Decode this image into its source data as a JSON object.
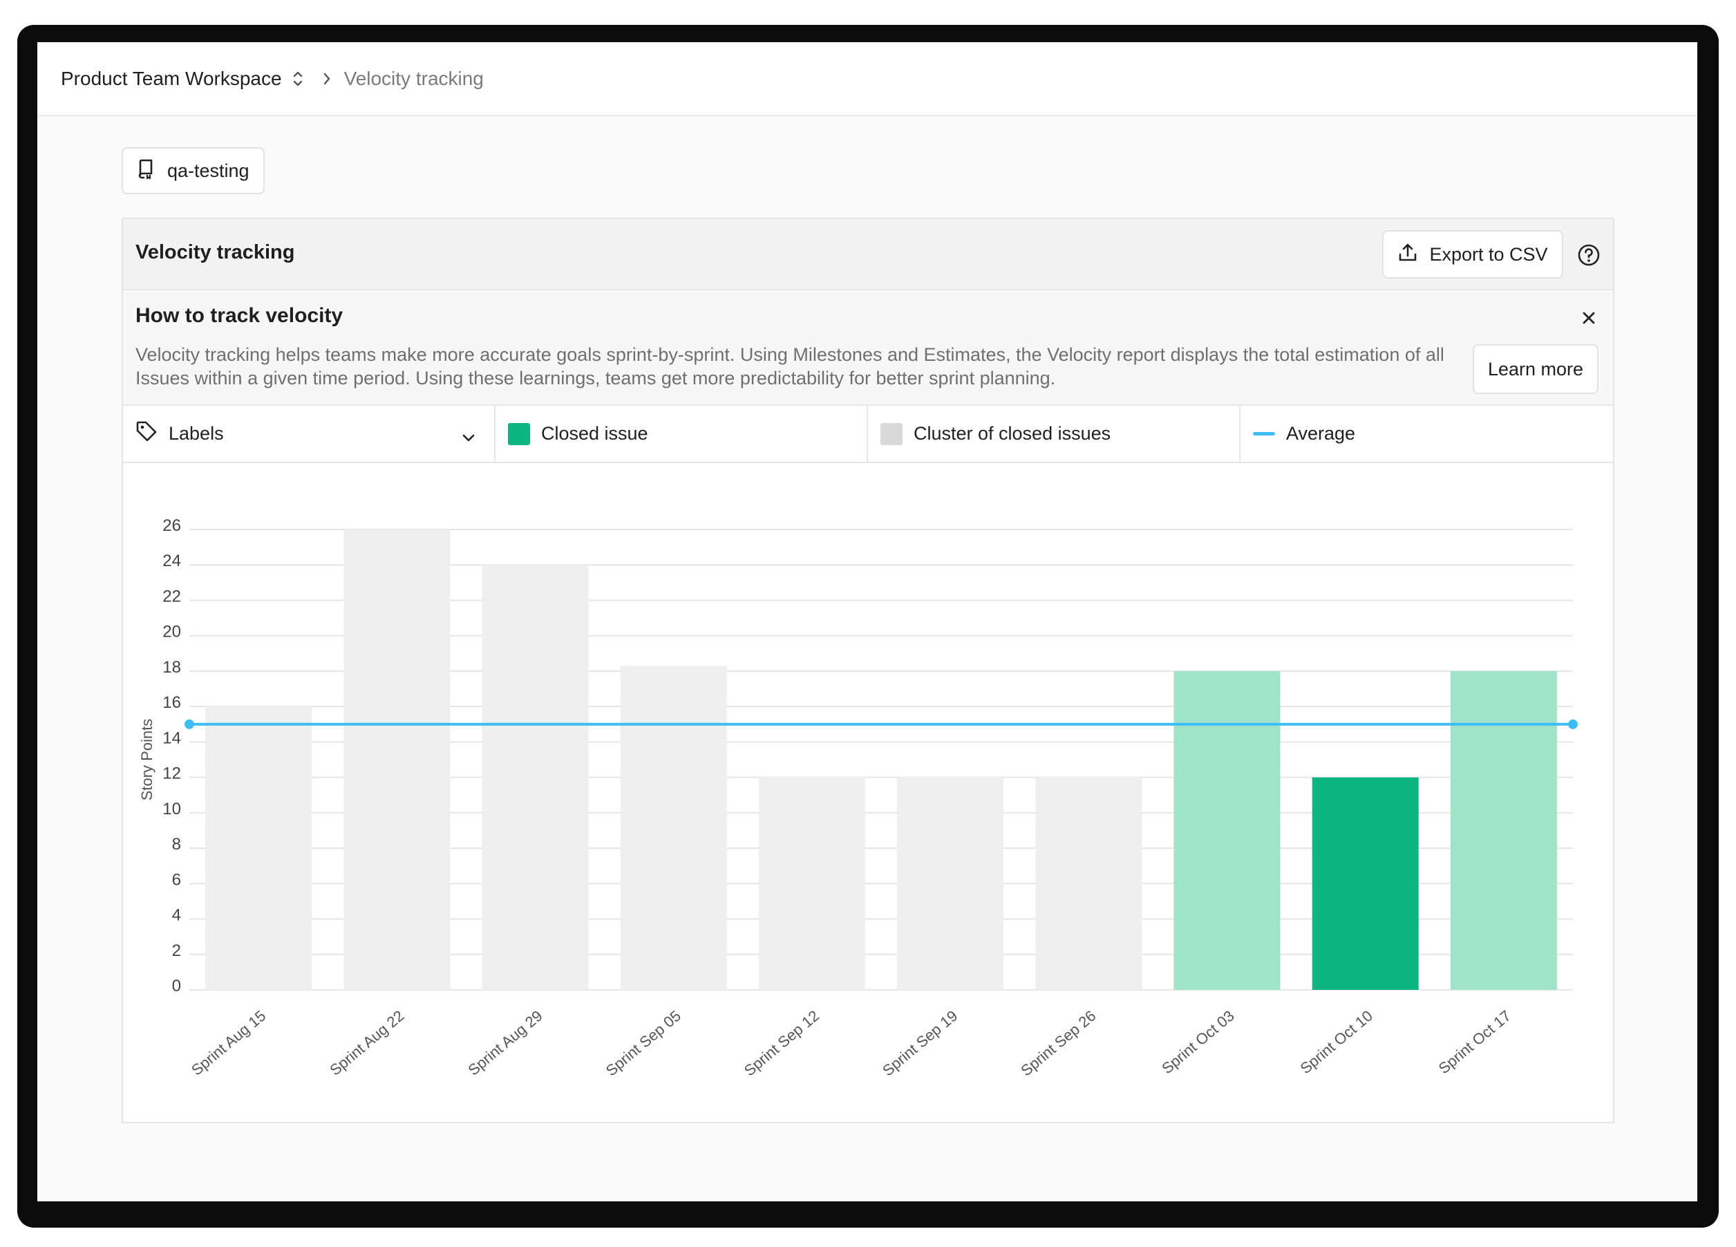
{
  "breadcrumb": {
    "workspace": "Product Team Workspace",
    "current": "Velocity tracking"
  },
  "repo_chip": {
    "label": "qa-testing",
    "icon": "repo-icon"
  },
  "card": {
    "title": "Velocity tracking",
    "export_label": "Export to CSV",
    "export_icon": "upload-icon",
    "help_icon": "question-circle-icon"
  },
  "info": {
    "title": "How to track velocity",
    "body": "Velocity tracking helps teams make more accurate goals sprint-by-sprint. Using Milestones and Estimates, the Velocity report displays the total estimation of all Issues within a given time period. Using these learnings, teams get more predictability for better sprint planning.",
    "learn_more": "Learn more",
    "close_icon": "close-icon"
  },
  "legend": {
    "labels": "Labels",
    "closed_issue": "Closed issue",
    "cluster": "Cluster of closed issues",
    "average": "Average"
  },
  "colors": {
    "closed_issue": "#0db57f",
    "closed_issue_light": "#9fe3c9",
    "cluster": "#d9d9d9",
    "cluster_bar": "#efefef",
    "average": "#3dbdf2"
  },
  "chart_data": {
    "type": "bar",
    "ylabel": "Story Points",
    "xlabel": "",
    "ylim": [
      0,
      26
    ],
    "yticks": [
      0,
      2,
      4,
      6,
      8,
      10,
      12,
      14,
      16,
      18,
      20,
      22,
      24,
      26
    ],
    "grid": true,
    "categories": [
      "Sprint Aug 15",
      "Sprint Aug 22",
      "Sprint Aug 29",
      "Sprint Sep 05",
      "Sprint Sep 12",
      "Sprint Sep 19",
      "Sprint Sep 26",
      "Sprint Oct 03",
      "Sprint Oct 10",
      "Sprint Oct 17"
    ],
    "values": [
      16,
      26,
      24,
      18.3,
      12,
      12,
      12,
      18,
      12,
      18
    ],
    "bar_kind": [
      "cluster",
      "cluster",
      "cluster",
      "cluster",
      "cluster",
      "cluster",
      "cluster",
      "closed_light",
      "closed",
      "closed_light"
    ],
    "average": 15
  }
}
